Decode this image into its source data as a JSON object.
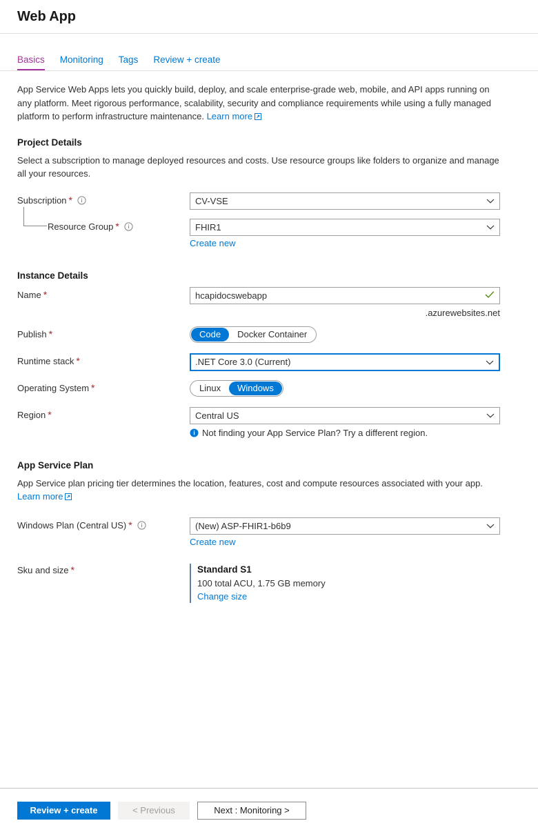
{
  "header": {
    "title": "Web App"
  },
  "tabs": [
    {
      "label": "Basics",
      "active": true
    },
    {
      "label": "Monitoring",
      "active": false
    },
    {
      "label": "Tags",
      "active": false
    },
    {
      "label": "Review + create",
      "active": false
    }
  ],
  "intro": {
    "text": "App Service Web Apps lets you quickly build, deploy, and scale enterprise-grade web, mobile, and API apps running on any platform. Meet rigorous performance, scalability, security and compliance requirements while using a fully managed platform to perform infrastructure maintenance.",
    "learn_more": "Learn more"
  },
  "project_details": {
    "title": "Project Details",
    "description": "Select a subscription to manage deployed resources and costs. Use resource groups like folders to organize and manage all your resources.",
    "subscription": {
      "label": "Subscription",
      "required": "*",
      "value": "CV-VSE",
      "info_icon": "info-circle-outline-icon"
    },
    "resource_group": {
      "label": "Resource Group",
      "required": "*",
      "value": "FHIR1",
      "create_new": "Create new",
      "info_icon": "info-circle-outline-icon"
    }
  },
  "instance_details": {
    "title": "Instance Details",
    "name": {
      "label": "Name",
      "required": "*",
      "value": "hcapidocswebapp",
      "placeholder": "Web app name",
      "suffix": ".azurewebsites.net",
      "valid_icon": "checkmark-icon"
    },
    "publish": {
      "label": "Publish",
      "required": "*",
      "options": [
        "Code",
        "Docker Container"
      ],
      "selected": "Code"
    },
    "runtime_stack": {
      "label": "Runtime stack",
      "required": "*",
      "value": ".NET Core 3.0 (Current)",
      "focused": true
    },
    "operating_system": {
      "label": "Operating System",
      "required": "*",
      "options": [
        "Linux",
        "Windows"
      ],
      "selected": "Windows"
    },
    "region": {
      "label": "Region",
      "required": "*",
      "value": "Central US",
      "hint": "Not finding your App Service Plan? Try a different region.",
      "hint_icon": "info-circle-filled-icon"
    }
  },
  "app_service_plan": {
    "title": "App Service Plan",
    "description": "App Service plan pricing tier determines the location, features, cost and compute resources associated with your app.",
    "learn_more": "Learn more",
    "windows_plan": {
      "label": "Windows Plan (Central US)",
      "required": "*",
      "value": "(New) ASP-FHIR1-b6b9",
      "create_new": "Create new",
      "info_icon": "info-circle-outline-icon"
    },
    "sku_and_size": {
      "label": "Sku and size",
      "required": "*",
      "name": "Standard S1",
      "spec": "100 total ACU, 1.75 GB memory",
      "change_size": "Change size"
    }
  },
  "footer": {
    "review_create": "Review + create",
    "previous": "< Previous",
    "next": "Next : Monitoring >"
  },
  "colors": {
    "accent": "#0078d4",
    "active_tab": "#a4339e",
    "required": "#a4262c",
    "valid": "#498205",
    "sku_bar": "#5e7fa8"
  }
}
